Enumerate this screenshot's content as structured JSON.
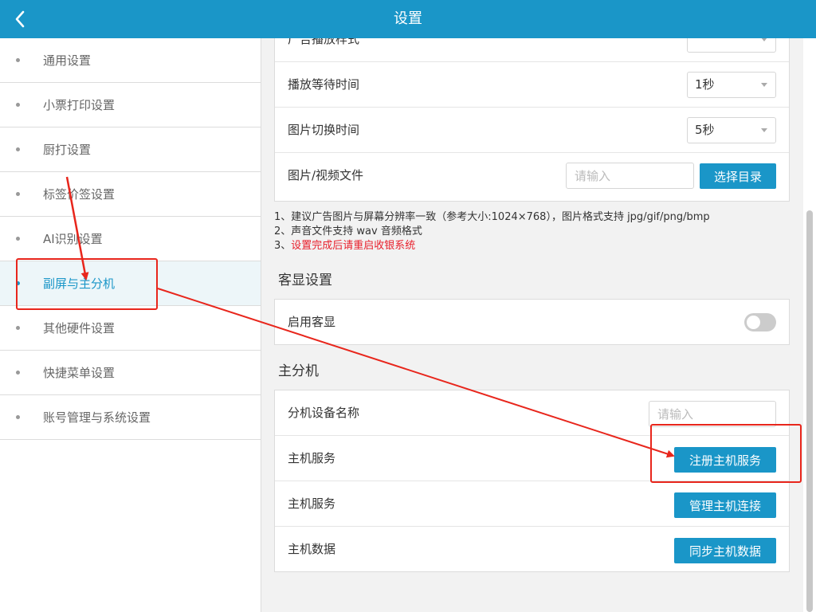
{
  "header": {
    "title": "设置",
    "back_icon": "chevron-left-icon"
  },
  "sidebar": {
    "items": [
      {
        "label": "通用设置",
        "active": false
      },
      {
        "label": "小票打印设置",
        "active": false
      },
      {
        "label": "厨打设置",
        "active": false
      },
      {
        "label": "标签价签设置",
        "active": false
      },
      {
        "label": "AI识别设置",
        "active": false
      },
      {
        "label": "副屏与主分机",
        "active": true
      },
      {
        "label": "其他硬件设置",
        "active": false
      },
      {
        "label": "快捷菜单设置",
        "active": false
      },
      {
        "label": "账号管理与系统设置",
        "active": false
      }
    ]
  },
  "ad_settings": {
    "partial_row_label": "广告播放样式",
    "rows": [
      {
        "label": "播放等待时间",
        "value": "1秒"
      },
      {
        "label": "图片切换时间",
        "value": "5秒"
      }
    ],
    "file_row": {
      "label": "图片/视频文件",
      "placeholder": "请输入",
      "button": "选择目录"
    },
    "notes": [
      "1、建议广告图片与屏幕分辨率一致（参考大小:1024×768），图片格式支持 jpg/gif/png/bmp",
      "2、声音文件支持 wav 音频格式"
    ],
    "note3_prefix": "3、",
    "note3_warning": "设置完成后请重启收银系统"
  },
  "customer_display": {
    "section_title": "客显设置",
    "enable_label": "启用客显",
    "enabled": false
  },
  "master_slave": {
    "section_title": "主分机",
    "device_name_label": "分机设备名称",
    "device_name_placeholder": "请输入",
    "rows": [
      {
        "label": "主机服务",
        "button": "注册主机服务"
      },
      {
        "label": "主机服务",
        "button": "管理主机连接"
      },
      {
        "label": "主机数据",
        "button": "同步主机数据"
      }
    ]
  },
  "colors": {
    "primary": "#1a96c8",
    "annotation": "#e8261c",
    "warning": "#e8202c"
  }
}
